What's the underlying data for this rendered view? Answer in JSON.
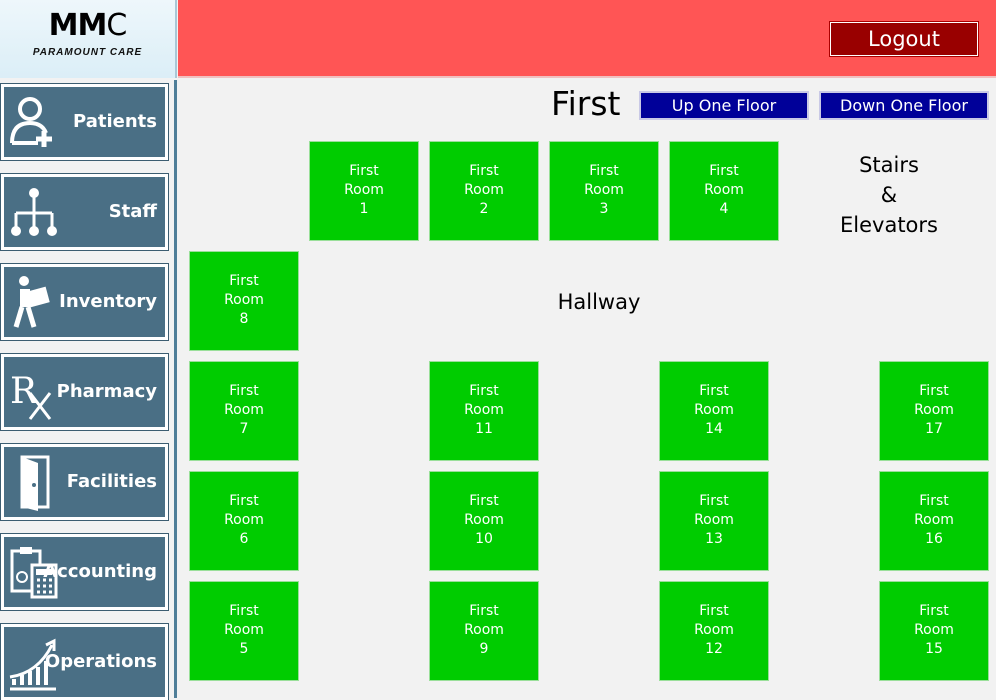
{
  "logo": {
    "mark_bold": "MM",
    "mark_thin": "C",
    "subtitle": "PARAMOUNT CARE"
  },
  "header": {
    "logout_label": "Logout"
  },
  "sidebar": {
    "items": [
      {
        "label": "Patients",
        "icon": "patient-icon"
      },
      {
        "label": "Staff",
        "icon": "org-chart-icon"
      },
      {
        "label": "Inventory",
        "icon": "person-carrying-box-icon"
      },
      {
        "label": "Pharmacy",
        "icon": "rx-icon"
      },
      {
        "label": "Facilities",
        "icon": "door-icon"
      },
      {
        "label": "Accounting",
        "icon": "clipboard-calculator-icon"
      },
      {
        "label": "Operations",
        "icon": "growth-chart-icon"
      }
    ]
  },
  "floor": {
    "title": "First",
    "up_label": "Up One Floor",
    "down_label": "Down One Floor",
    "stairs_label": [
      "Stairs",
      "&",
      "Elevators"
    ],
    "hallway_label": "Hallway"
  },
  "rooms": {
    "r1": {
      "line1": "First",
      "line2": "Room",
      "number": "1"
    },
    "r2": {
      "line1": "First",
      "line2": "Room",
      "number": "2"
    },
    "r3": {
      "line1": "First",
      "line2": "Room",
      "number": "3"
    },
    "r4": {
      "line1": "First",
      "line2": "Room",
      "number": "4"
    },
    "r5": {
      "line1": "First",
      "line2": "Room",
      "number": "5"
    },
    "r6": {
      "line1": "First",
      "line2": "Room",
      "number": "6"
    },
    "r7": {
      "line1": "First",
      "line2": "Room",
      "number": "7"
    },
    "r8": {
      "line1": "First",
      "line2": "Room",
      "number": "8"
    },
    "r9": {
      "line1": "First",
      "line2": "Room",
      "number": "9"
    },
    "r10": {
      "line1": "First",
      "line2": "Room",
      "number": "10"
    },
    "r11": {
      "line1": "First",
      "line2": "Room",
      "number": "11"
    },
    "r12": {
      "line1": "First",
      "line2": "Room",
      "number": "12"
    },
    "r13": {
      "line1": "First",
      "line2": "Room",
      "number": "13"
    },
    "r14": {
      "line1": "First",
      "line2": "Room",
      "number": "14"
    },
    "r15": {
      "line1": "First",
      "line2": "Room",
      "number": "15"
    },
    "r16": {
      "line1": "First",
      "line2": "Room",
      "number": "16"
    },
    "r17": {
      "line1": "First",
      "line2": "Room",
      "number": "17"
    }
  },
  "colors": {
    "header": "#ff5555",
    "logout": "#990000",
    "nav": "#4a6f85",
    "floor_button": "#000099",
    "room": "#00cc00"
  }
}
